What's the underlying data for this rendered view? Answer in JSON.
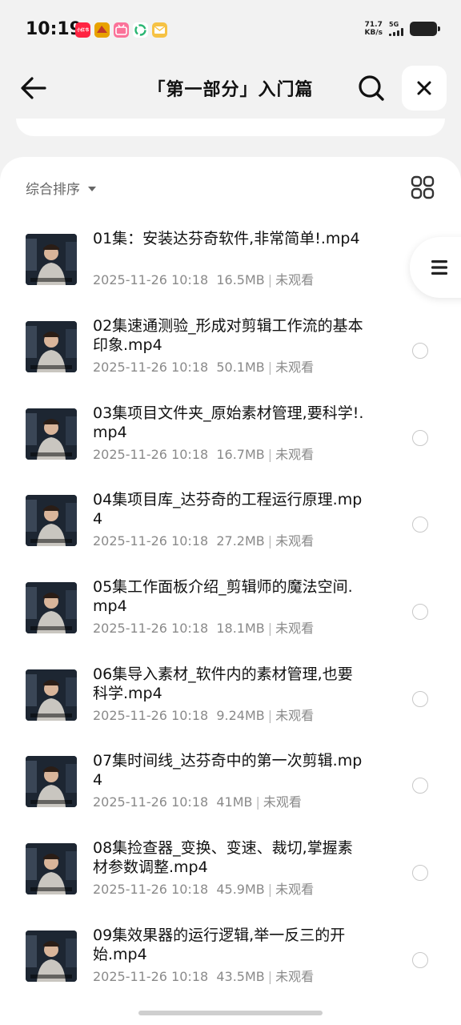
{
  "status_bar": {
    "time": "10:19",
    "notifications": [
      {
        "name": "xiaohongshu-notif-icon",
        "label": "小红书",
        "color": "#ff2442"
      },
      {
        "name": "game-notif-icon",
        "label": "",
        "color": "#f2a000"
      },
      {
        "name": "bilibili-notif-icon",
        "label": "",
        "color": "#fb7299"
      },
      {
        "name": "sync-notif-icon",
        "label": "",
        "color": "#2bb673"
      },
      {
        "name": "mail-notif-icon",
        "label": "",
        "color": "#f6c244"
      }
    ],
    "net_speed_value": "71.7",
    "net_speed_unit": "KB/s",
    "network_type": "5G",
    "battery_icon": "battery-icon"
  },
  "header": {
    "title": "「第一部分」入门篇",
    "back_icon": "arrow-left-icon",
    "search_icon": "search-icon",
    "close_icon": "close-icon"
  },
  "toolbar": {
    "sort_label": "综合排序",
    "sort_icon": "caret-down-icon",
    "view_toggle_icon": "grid-view-icon"
  },
  "float_menu_icon": "menu-icon",
  "files": [
    {
      "title": "01集：安装达芬奇软件,非常简单!.mp4",
      "date": "2025-11-26 10:18",
      "size": "16.5MB",
      "status": "未观看"
    },
    {
      "title": "02集速通测验_形成对剪辑工作流的基本印象.mp4",
      "date": "2025-11-26 10:18",
      "size": "50.1MB",
      "status": "未观看"
    },
    {
      "title": "03集项目文件夹_原始素材管理,要科学!.mp4",
      "date": "2025-11-26 10:18",
      "size": "16.7MB",
      "status": "未观看"
    },
    {
      "title": "04集项目库_达芬奇的工程运行原理.mp4",
      "date": "2025-11-26 10:18",
      "size": "27.2MB",
      "status": "未观看"
    },
    {
      "title": "05集工作面板介绍_剪辑师的魔法空间.mp4",
      "date": "2025-11-26 10:18",
      "size": "18.1MB",
      "status": "未观看"
    },
    {
      "title": "06集导入素材_软件内的素材管理,也要科学.mp4",
      "date": "2025-11-26 10:18",
      "size": "9.24MB",
      "status": "未观看"
    },
    {
      "title": "07集时间线_达芬奇中的第一次剪辑.mp4",
      "date": "2025-11-26 10:18",
      "size": "41MB",
      "status": "未观看"
    },
    {
      "title": "08集捡查器_变换、变速、裁切,掌握素材参数调整.mp4",
      "date": "2025-11-26 10:18",
      "size": "45.9MB",
      "status": "未观看"
    },
    {
      "title": "09集效果器的运行逻辑,举一反三的开始.mp4",
      "date": "2025-11-26 10:18",
      "size": "43.5MB",
      "status": "未观看"
    }
  ]
}
